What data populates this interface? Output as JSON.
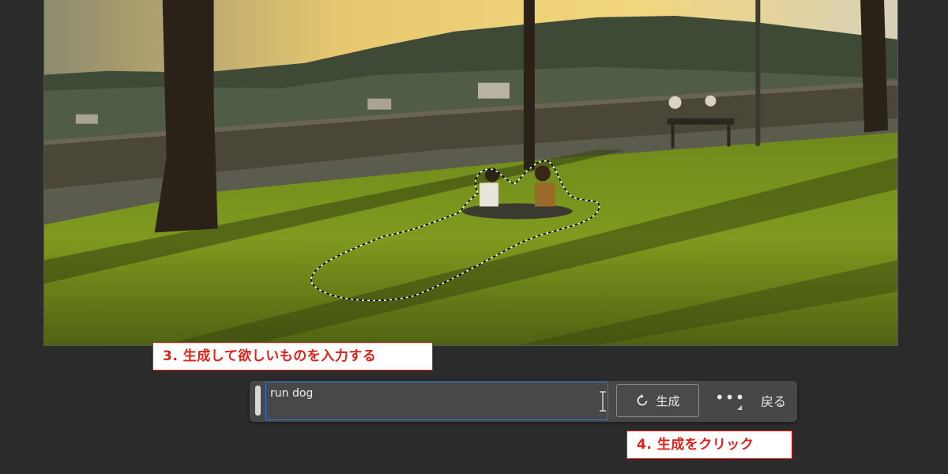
{
  "annotations": {
    "step3": "3. 生成して欲しいものを入力する",
    "step4": "4. 生成をクリック"
  },
  "taskbar": {
    "prompt_value": "run dog",
    "generate_label": "生成",
    "more_label": "•••",
    "back_label": "戻る"
  },
  "icons": {
    "generate": "refresh-arrow-icon",
    "more": "ellipsis-icon",
    "caret": "text-i-beam-icon"
  },
  "colors": {
    "background": "#2b2b2b",
    "taskbar": "#474747",
    "focus_border": "#2c79e0",
    "callout_red": "#e0211a"
  }
}
